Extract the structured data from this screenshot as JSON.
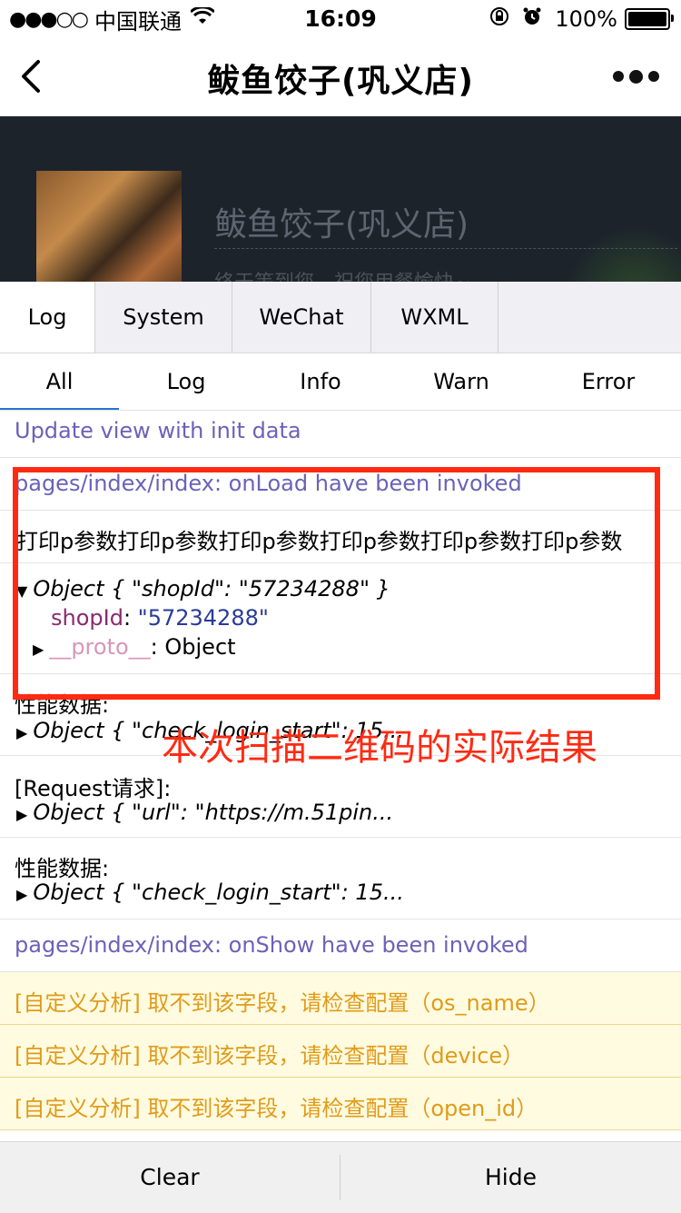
{
  "status_bar": {
    "signal": "●●●○○",
    "carrier": "中国联通",
    "time": "16:09",
    "battery": "100%"
  },
  "nav": {
    "title": "鲅鱼饺子(巩义店)"
  },
  "page": {
    "shop_name": "鲅鱼饺子(巩义店)",
    "slogan": "终于等到您，祝您用餐愉快~"
  },
  "console": {
    "top_tabs": [
      "Log",
      "System",
      "WeChat",
      "WXML"
    ],
    "filter_tabs": [
      "All",
      "Log",
      "Info",
      "Warn",
      "Error"
    ],
    "logs": {
      "update_view": "Update view with init data",
      "onload": "pages/index/index: onLoad have been invoked",
      "params": "打印p参数打印p参数打印p参数打印p参数打印p参数打印p参数",
      "object_summary": "Object { \"shopId\": \"57234288\" }",
      "shop_key": "shopId",
      "shop_value": "\"57234288\"",
      "proto_key": "__proto__",
      "proto_value": ": Object",
      "perf_label_1": "性能数据:",
      "perf_obj_1": "Object { \"check_login_start\": 15...",
      "request_label": "[Request请求]:",
      "request_obj": "Object { \"url\": \"https://m.51pin...",
      "perf_label_2": "性能数据:",
      "perf_obj_2": "Object { \"check_login_start\": 15...",
      "onshow": "pages/index/index: onShow have been invoked",
      "warn_1": "[自定义分析] 取不到该字段，请检查配置（os_name）",
      "warn_2": "[自定义分析] 取不到该字段，请检查配置（device）",
      "warn_3": "[自定义分析] 取不到该字段，请检查配置（open_id）"
    },
    "buttons": {
      "clear": "Clear",
      "hide": "Hide"
    }
  },
  "annotation": "本次扫描二维码的实际结果",
  "colors": {
    "annotation_red": "#ff2a12",
    "log_purple": "#6a62b8",
    "warn_text": "#e09b1a",
    "warn_bg": "#fffbe0"
  }
}
